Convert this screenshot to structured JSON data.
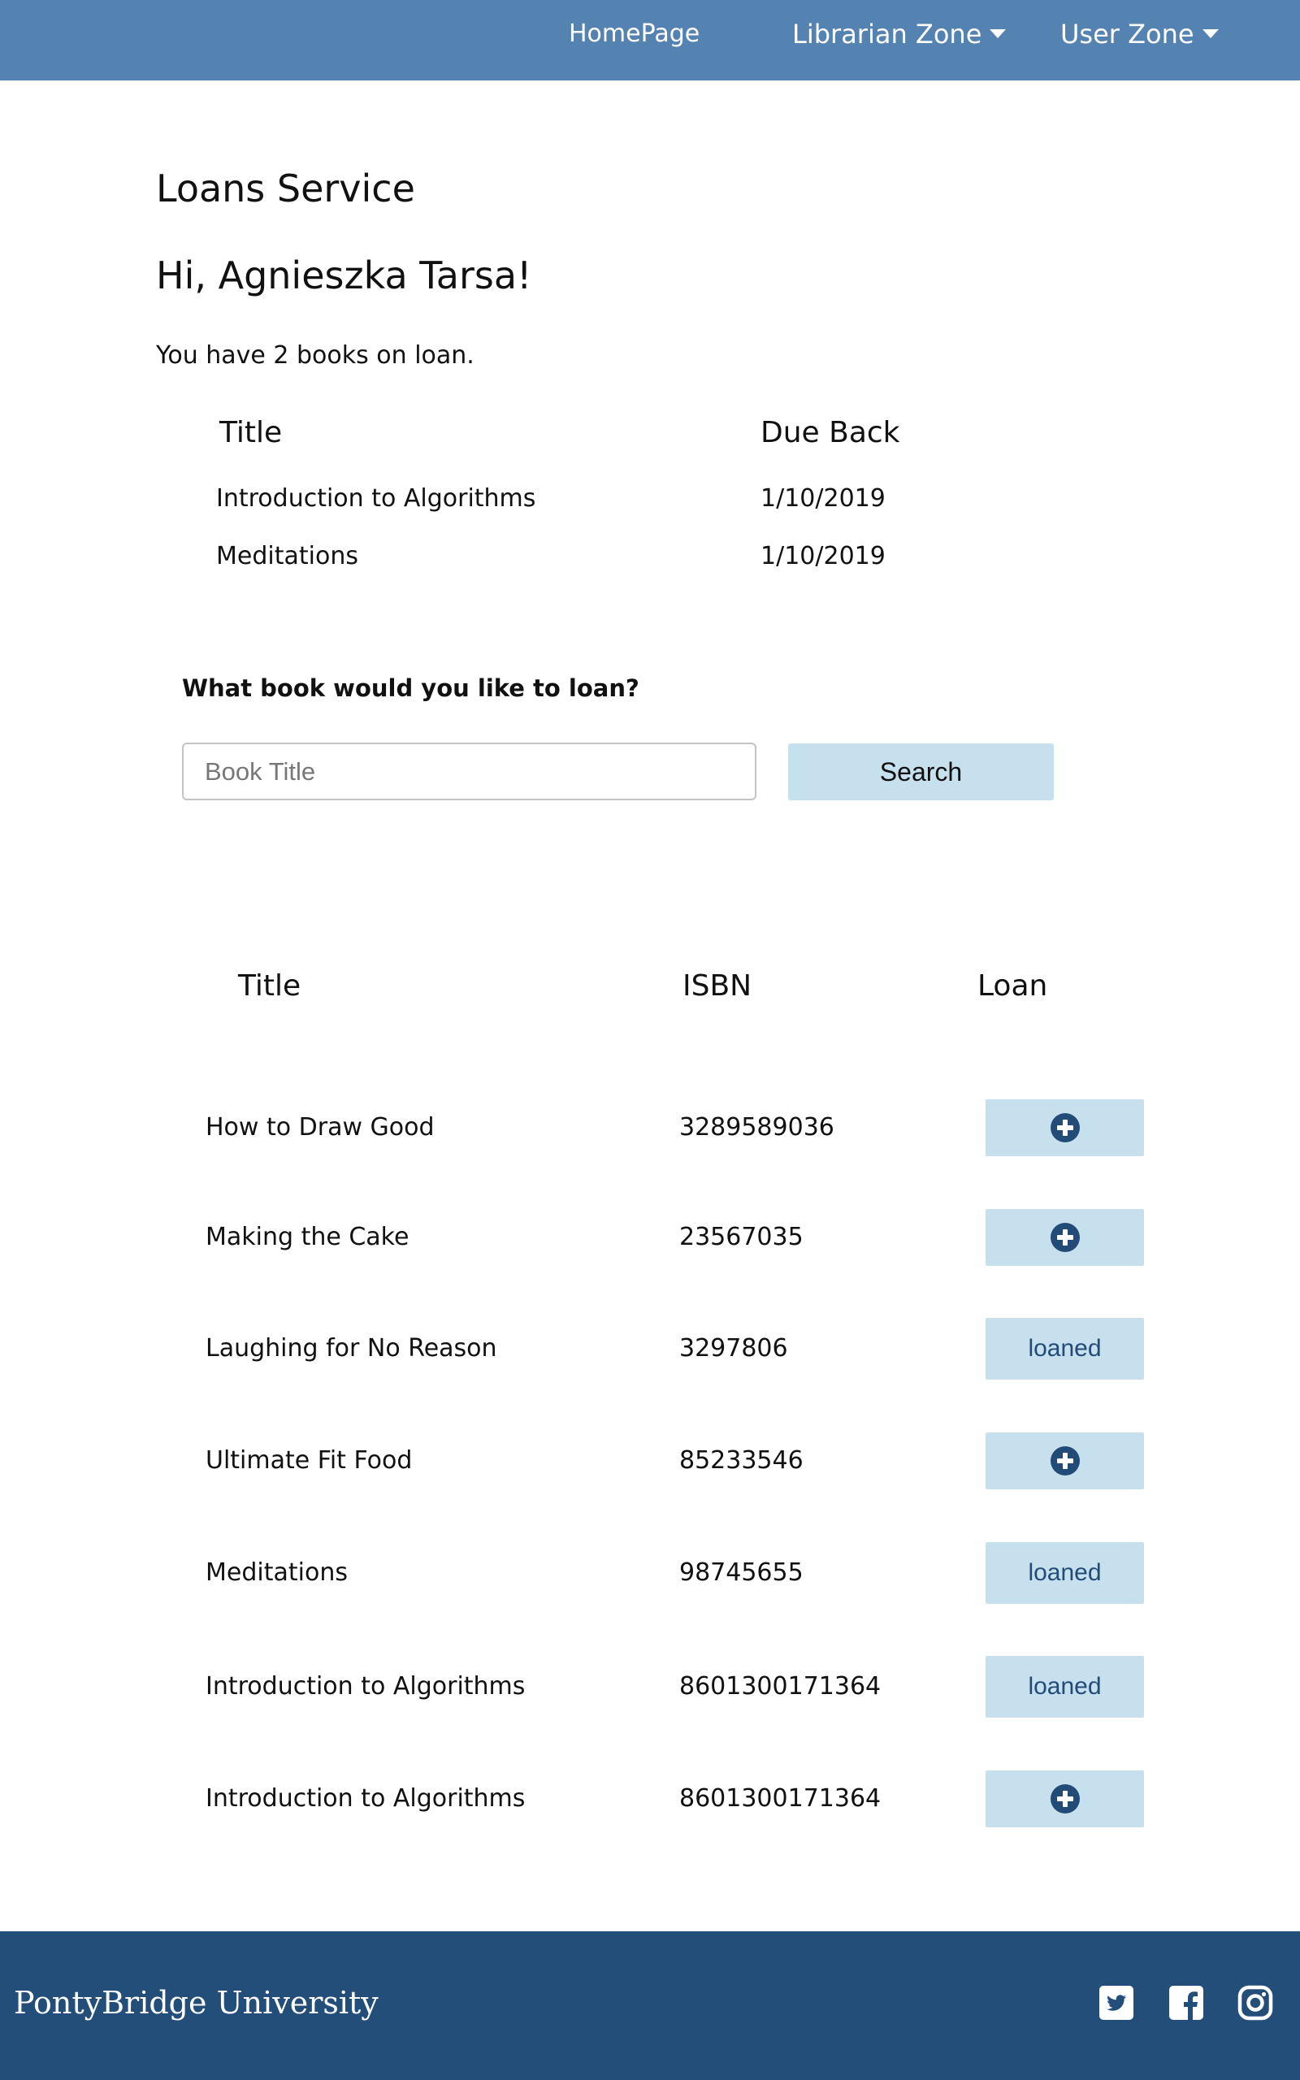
{
  "nav": {
    "home": "HomePage",
    "librarian": "Librarian Zone",
    "user": "User Zone",
    "caret_icon": "caret-down-icon"
  },
  "page": {
    "title": "Loans Service",
    "greeting": "Hi, Agnieszka Tarsa!",
    "loan_count_text": "You have 2 books on loan."
  },
  "loans_table": {
    "headers": {
      "title": "Title",
      "due": "Due Back"
    },
    "rows": [
      {
        "title": "Introduction to Algorithms",
        "due": "1/10/2019"
      },
      {
        "title": "Meditations",
        "due": "1/10/2019"
      }
    ]
  },
  "search": {
    "prompt": "What book would you like to loan?",
    "placeholder": "Book Title",
    "value": "",
    "button_label": "Search"
  },
  "results_table": {
    "headers": {
      "title": "Title",
      "isbn": "ISBN",
      "loan": "Loan"
    },
    "add_icon": "plus-circle-icon",
    "rows": [
      {
        "title": "How to Draw Good",
        "isbn": "3289589036",
        "status": "available"
      },
      {
        "title": "Making the Cake",
        "isbn": "23567035",
        "status": "available"
      },
      {
        "title": "Laughing for No Reason",
        "isbn": "3297806",
        "status": "loaned",
        "status_label": "loaned"
      },
      {
        "title": "Ultimate Fit Food",
        "isbn": "85233546",
        "status": "available"
      },
      {
        "title": "Meditations",
        "isbn": "98745655",
        "status": "loaned",
        "status_label": "loaned"
      },
      {
        "title": "Introduction to Algorithms",
        "isbn": "8601300171364",
        "status": "loaned",
        "status_label": "loaned"
      },
      {
        "title": "Introduction to Algorithms",
        "isbn": "8601300171364",
        "status": "available"
      }
    ]
  },
  "footer": {
    "brand": "PontyBridge University",
    "social_icons": [
      "twitter-icon",
      "facebook-icon",
      "instagram-icon"
    ]
  },
  "colors": {
    "nav_bg": "#5483b1",
    "footer_bg": "#244e7a",
    "button_bg": "#c7e0ee",
    "icon_dark": "#234b78"
  }
}
